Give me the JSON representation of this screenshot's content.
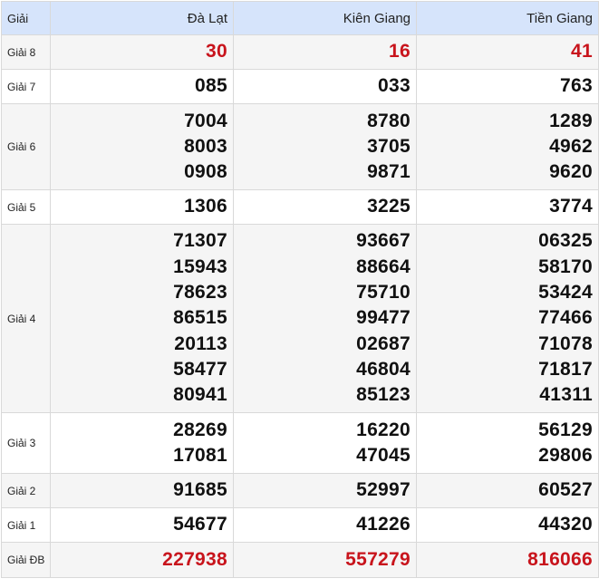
{
  "header": {
    "prize_col": "Giải",
    "provinces": [
      "Đà Lạt",
      "Kiên Giang",
      "Tiền Giang"
    ]
  },
  "rows": [
    {
      "label": "Giải 8",
      "values": [
        [
          "30"
        ],
        [
          "16"
        ],
        [
          "41"
        ]
      ]
    },
    {
      "label": "Giải 7",
      "values": [
        [
          "085"
        ],
        [
          "033"
        ],
        [
          "763"
        ]
      ]
    },
    {
      "label": "Giải 6",
      "values": [
        [
          "7004",
          "8003",
          "0908"
        ],
        [
          "8780",
          "3705",
          "9871"
        ],
        [
          "1289",
          "4962",
          "9620"
        ]
      ]
    },
    {
      "label": "Giải 5",
      "values": [
        [
          "1306"
        ],
        [
          "3225"
        ],
        [
          "3774"
        ]
      ]
    },
    {
      "label": "Giải 4",
      "values": [
        [
          "71307",
          "15943",
          "78623",
          "86515",
          "20113",
          "58477",
          "80941"
        ],
        [
          "93667",
          "88664",
          "75710",
          "99477",
          "02687",
          "46804",
          "85123"
        ],
        [
          "06325",
          "58170",
          "53424",
          "77466",
          "71078",
          "71817",
          "41311"
        ]
      ]
    },
    {
      "label": "Giải 3",
      "values": [
        [
          "28269",
          "17081"
        ],
        [
          "16220",
          "47045"
        ],
        [
          "56129",
          "29806"
        ]
      ]
    },
    {
      "label": "Giải 2",
      "values": [
        [
          "91685"
        ],
        [
          "52997"
        ],
        [
          "60527"
        ]
      ]
    },
    {
      "label": "Giải 1",
      "values": [
        [
          "54677"
        ],
        [
          "41226"
        ],
        [
          "44320"
        ]
      ]
    },
    {
      "label": "Giải ĐB",
      "values": [
        [
          "227938"
        ],
        [
          "557279"
        ],
        [
          "816066"
        ]
      ]
    }
  ],
  "colors": {
    "header_bg": "#d6e4fb",
    "highlight_red": "#c8141c",
    "shaded_row": "#f5f5f5"
  }
}
